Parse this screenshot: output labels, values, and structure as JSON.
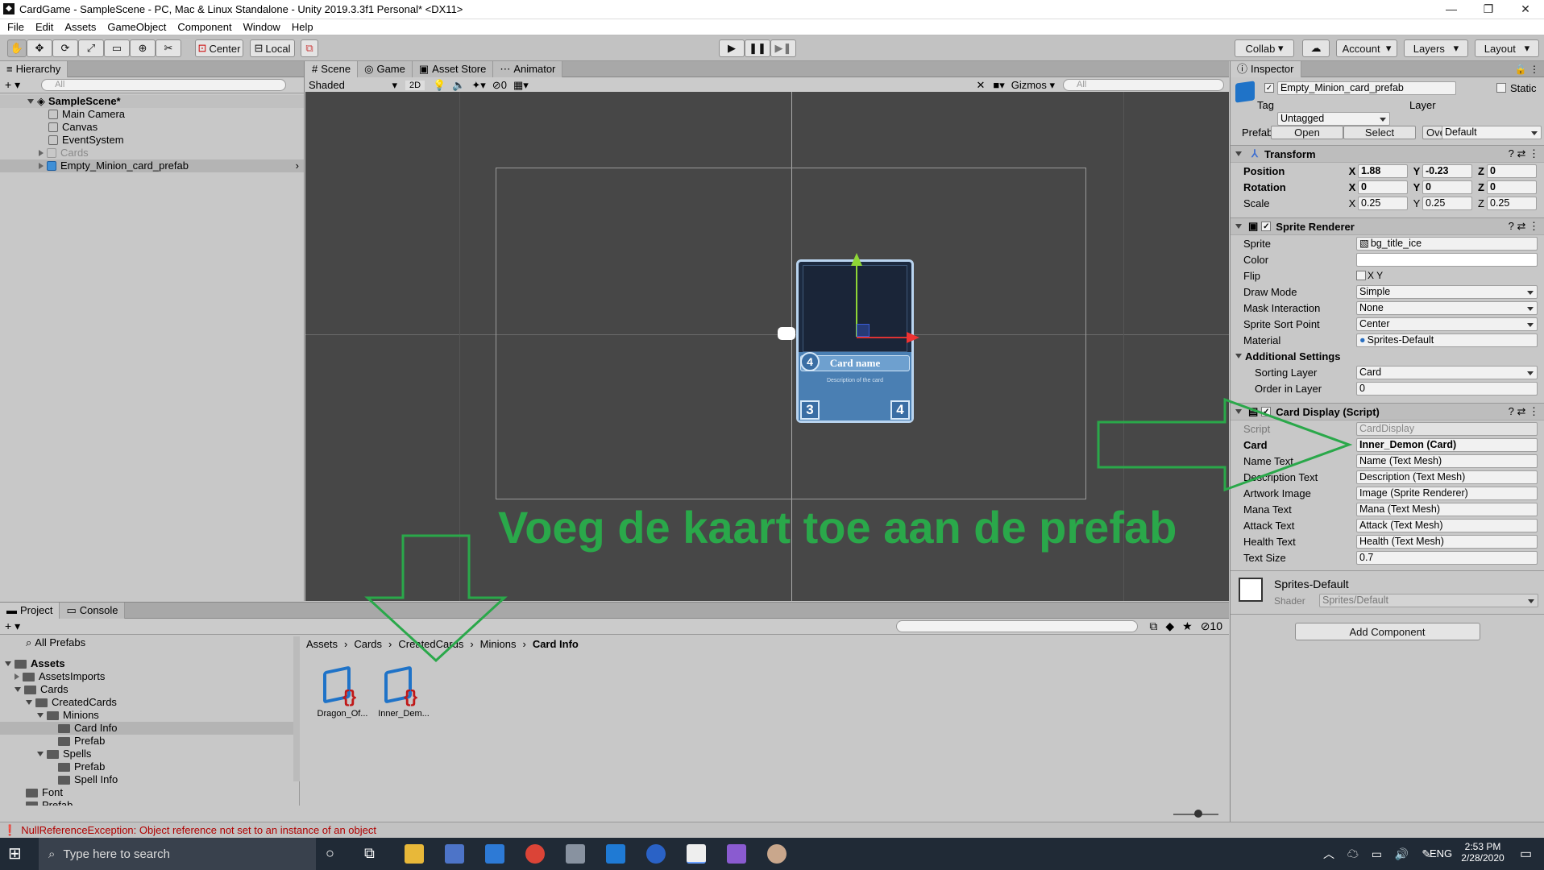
{
  "window": {
    "title": "CardGame - SampleScene - PC, Mac & Linux Standalone - Unity 2019.3.3f1 Personal* <DX11>"
  },
  "menu": [
    "File",
    "Edit",
    "Assets",
    "GameObject",
    "Component",
    "Window",
    "Help"
  ],
  "toolbar": {
    "center": "Center",
    "local": "Local",
    "collab": "Collab",
    "account": "Account",
    "layers": "Layers",
    "layout": "Layout"
  },
  "hierarchy": {
    "tab": "Hierarchy",
    "search": "All",
    "scene": "SampleScene*",
    "items": [
      "Main Camera",
      "Canvas",
      "EventSystem",
      "Cards",
      "Empty_Minion_card_prefab"
    ]
  },
  "scene": {
    "tabs": [
      "Scene",
      "Game",
      "Asset Store",
      "Animator"
    ],
    "shading": "Shaded",
    "mode2d": "2D",
    "hidden_count": "0",
    "gizmos": "Gizmos",
    "search": "All",
    "card": {
      "mana": "4",
      "name": "Card name",
      "description": "Description of the card",
      "attack": "3",
      "health": "4"
    }
  },
  "annotation": {
    "text": "Voeg de kaart toe aan de prefab",
    "color": "#2aa84a"
  },
  "inspector": {
    "tab": "Inspector",
    "object_name": "Empty_Minion_card_prefab",
    "static": "Static",
    "tag_label": "Tag",
    "tag": "Untagged",
    "layer_label": "Layer",
    "layer": "Default",
    "prefab_label": "Prefab",
    "open": "Open",
    "select": "Select",
    "overrides": "Overrides",
    "transform": {
      "title": "Transform",
      "position": {
        "label": "Position",
        "x": "1.88",
        "y": "-0.23",
        "z": "0"
      },
      "rotation": {
        "label": "Rotation",
        "x": "0",
        "y": "0",
        "z": "0"
      },
      "scale": {
        "label": "Scale",
        "x": "0.25",
        "y": "0.25",
        "z": "0.25"
      }
    },
    "sprite_renderer": {
      "title": "Sprite Renderer",
      "rows": [
        {
          "label": "Sprite",
          "value": "bg_title_ice"
        },
        {
          "label": "Color",
          "value": ""
        },
        {
          "label": "Flip",
          "value": "X      Y"
        },
        {
          "label": "Draw Mode",
          "value": "Simple"
        },
        {
          "label": "Mask Interaction",
          "value": "None"
        },
        {
          "label": "Sprite Sort Point",
          "value": "Center"
        },
        {
          "label": "Material",
          "value": "Sprites-Default"
        }
      ],
      "additional": "Additional Settings",
      "sorting_layer": {
        "label": "Sorting Layer",
        "value": "Card"
      },
      "order": {
        "label": "Order in Layer",
        "value": "0"
      }
    },
    "card_display": {
      "title": "Card Display (Script)",
      "rows": [
        {
          "label": "Script",
          "value": "CardDisplay"
        },
        {
          "label": "Card",
          "value": "Inner_Demon (Card)"
        },
        {
          "label": "Name Text",
          "value": "Name (Text Mesh)"
        },
        {
          "label": "Description Text",
          "value": "Description (Text Mesh)"
        },
        {
          "label": "Artwork Image",
          "value": "Image (Sprite Renderer)"
        },
        {
          "label": "Mana Text",
          "value": "Mana (Text Mesh)"
        },
        {
          "label": "Attack Text",
          "value": "Attack (Text Mesh)"
        },
        {
          "label": "Health Text",
          "value": "Health (Text Mesh)"
        },
        {
          "label": "Text Size",
          "value": "0.7"
        }
      ]
    },
    "material": {
      "name": "Sprites-Default",
      "shader_label": "Shader",
      "shader": "Sprites/Default"
    },
    "add_component": "Add Component"
  },
  "project": {
    "tabs": [
      "Project",
      "Console"
    ],
    "hidden_count": "10",
    "tree": [
      {
        "label": "All Prefabs",
        "indent": 1
      },
      {
        "label": "Assets",
        "indent": 0
      },
      {
        "label": "AssetsImports",
        "indent": 1
      },
      {
        "label": "Cards",
        "indent": 1
      },
      {
        "label": "CreatedCards",
        "indent": 2
      },
      {
        "label": "Minions",
        "indent": 3
      },
      {
        "label": "Card Info",
        "indent": 4
      },
      {
        "label": "Prefab",
        "indent": 4
      },
      {
        "label": "Spells",
        "indent": 3
      },
      {
        "label": "Prefab",
        "indent": 4
      },
      {
        "label": "Spell Info",
        "indent": 4
      },
      {
        "label": "Font",
        "indent": 1
      },
      {
        "label": "Prefab",
        "indent": 1
      }
    ],
    "breadcrumb": [
      "Assets",
      "Cards",
      "CreatedCards",
      "Minions",
      "Card Info"
    ],
    "assets": [
      "Dragon_Of...",
      "Inner_Dem..."
    ]
  },
  "status": {
    "error": "NullReferenceException: Object reference not set to an instance of an object"
  },
  "taskbar": {
    "search": "Type here to search",
    "lang": "ENG",
    "time": "2:53 PM",
    "date": "2/28/2020"
  }
}
